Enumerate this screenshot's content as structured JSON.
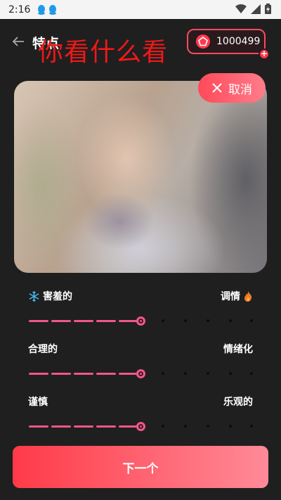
{
  "status_bar": {
    "time": "2:16"
  },
  "header": {
    "title": "特点",
    "overlay_text": "你看什么看",
    "coins": "1000499"
  },
  "photo": {
    "cancel_label": "取消"
  },
  "sliders": [
    {
      "left_label": "害羞的",
      "right_label": "调情",
      "left_icon": "snowflake-icon",
      "right_icon": "flame-icon",
      "value_fraction": 0.5
    },
    {
      "left_label": "合理的",
      "right_label": "情绪化",
      "value_fraction": 0.5
    },
    {
      "left_label": "谨慎",
      "right_label": "乐观的",
      "value_fraction": 0.5
    }
  ],
  "footer": {
    "next_label": "下一个"
  },
  "colors": {
    "accent": "#ff4a5a",
    "slider": "#f2568a",
    "background": "#1f1f1f"
  }
}
